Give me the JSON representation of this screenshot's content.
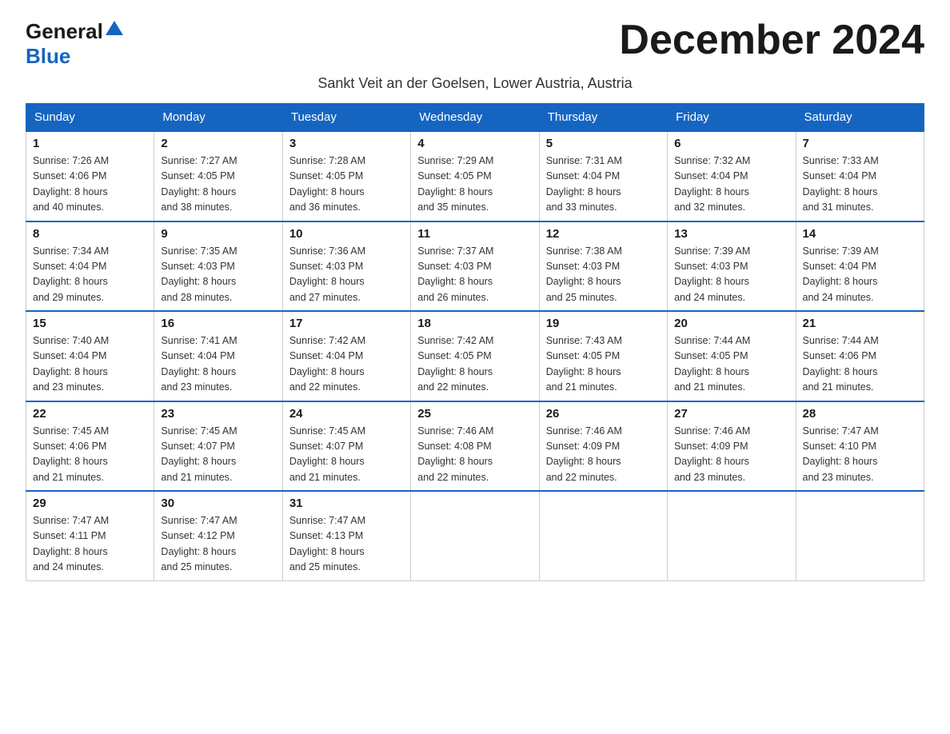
{
  "logo": {
    "general": "General",
    "blue": "Blue"
  },
  "title": "December 2024",
  "subtitle": "Sankt Veit an der Goelsen, Lower Austria, Austria",
  "days_of_week": [
    "Sunday",
    "Monday",
    "Tuesday",
    "Wednesday",
    "Thursday",
    "Friday",
    "Saturday"
  ],
  "weeks": [
    [
      {
        "day": "1",
        "sunrise": "7:26 AM",
        "sunset": "4:06 PM",
        "daylight": "8 hours and 40 minutes."
      },
      {
        "day": "2",
        "sunrise": "7:27 AM",
        "sunset": "4:05 PM",
        "daylight": "8 hours and 38 minutes."
      },
      {
        "day": "3",
        "sunrise": "7:28 AM",
        "sunset": "4:05 PM",
        "daylight": "8 hours and 36 minutes."
      },
      {
        "day": "4",
        "sunrise": "7:29 AM",
        "sunset": "4:05 PM",
        "daylight": "8 hours and 35 minutes."
      },
      {
        "day": "5",
        "sunrise": "7:31 AM",
        "sunset": "4:04 PM",
        "daylight": "8 hours and 33 minutes."
      },
      {
        "day": "6",
        "sunrise": "7:32 AM",
        "sunset": "4:04 PM",
        "daylight": "8 hours and 32 minutes."
      },
      {
        "day": "7",
        "sunrise": "7:33 AM",
        "sunset": "4:04 PM",
        "daylight": "8 hours and 31 minutes."
      }
    ],
    [
      {
        "day": "8",
        "sunrise": "7:34 AM",
        "sunset": "4:04 PM",
        "daylight": "8 hours and 29 minutes."
      },
      {
        "day": "9",
        "sunrise": "7:35 AM",
        "sunset": "4:03 PM",
        "daylight": "8 hours and 28 minutes."
      },
      {
        "day": "10",
        "sunrise": "7:36 AM",
        "sunset": "4:03 PM",
        "daylight": "8 hours and 27 minutes."
      },
      {
        "day": "11",
        "sunrise": "7:37 AM",
        "sunset": "4:03 PM",
        "daylight": "8 hours and 26 minutes."
      },
      {
        "day": "12",
        "sunrise": "7:38 AM",
        "sunset": "4:03 PM",
        "daylight": "8 hours and 25 minutes."
      },
      {
        "day": "13",
        "sunrise": "7:39 AM",
        "sunset": "4:03 PM",
        "daylight": "8 hours and 24 minutes."
      },
      {
        "day": "14",
        "sunrise": "7:39 AM",
        "sunset": "4:04 PM",
        "daylight": "8 hours and 24 minutes."
      }
    ],
    [
      {
        "day": "15",
        "sunrise": "7:40 AM",
        "sunset": "4:04 PM",
        "daylight": "8 hours and 23 minutes."
      },
      {
        "day": "16",
        "sunrise": "7:41 AM",
        "sunset": "4:04 PM",
        "daylight": "8 hours and 23 minutes."
      },
      {
        "day": "17",
        "sunrise": "7:42 AM",
        "sunset": "4:04 PM",
        "daylight": "8 hours and 22 minutes."
      },
      {
        "day": "18",
        "sunrise": "7:42 AM",
        "sunset": "4:05 PM",
        "daylight": "8 hours and 22 minutes."
      },
      {
        "day": "19",
        "sunrise": "7:43 AM",
        "sunset": "4:05 PM",
        "daylight": "8 hours and 21 minutes."
      },
      {
        "day": "20",
        "sunrise": "7:44 AM",
        "sunset": "4:05 PM",
        "daylight": "8 hours and 21 minutes."
      },
      {
        "day": "21",
        "sunrise": "7:44 AM",
        "sunset": "4:06 PM",
        "daylight": "8 hours and 21 minutes."
      }
    ],
    [
      {
        "day": "22",
        "sunrise": "7:45 AM",
        "sunset": "4:06 PM",
        "daylight": "8 hours and 21 minutes."
      },
      {
        "day": "23",
        "sunrise": "7:45 AM",
        "sunset": "4:07 PM",
        "daylight": "8 hours and 21 minutes."
      },
      {
        "day": "24",
        "sunrise": "7:45 AM",
        "sunset": "4:07 PM",
        "daylight": "8 hours and 21 minutes."
      },
      {
        "day": "25",
        "sunrise": "7:46 AM",
        "sunset": "4:08 PM",
        "daylight": "8 hours and 22 minutes."
      },
      {
        "day": "26",
        "sunrise": "7:46 AM",
        "sunset": "4:09 PM",
        "daylight": "8 hours and 22 minutes."
      },
      {
        "day": "27",
        "sunrise": "7:46 AM",
        "sunset": "4:09 PM",
        "daylight": "8 hours and 23 minutes."
      },
      {
        "day": "28",
        "sunrise": "7:47 AM",
        "sunset": "4:10 PM",
        "daylight": "8 hours and 23 minutes."
      }
    ],
    [
      {
        "day": "29",
        "sunrise": "7:47 AM",
        "sunset": "4:11 PM",
        "daylight": "8 hours and 24 minutes."
      },
      {
        "day": "30",
        "sunrise": "7:47 AM",
        "sunset": "4:12 PM",
        "daylight": "8 hours and 25 minutes."
      },
      {
        "day": "31",
        "sunrise": "7:47 AM",
        "sunset": "4:13 PM",
        "daylight": "8 hours and 25 minutes."
      },
      null,
      null,
      null,
      null
    ]
  ],
  "labels": {
    "sunrise": "Sunrise:",
    "sunset": "Sunset:",
    "daylight": "Daylight:"
  },
  "colors": {
    "header_bg": "#1565c0",
    "header_text": "#ffffff",
    "border_top": "#1565c0"
  }
}
